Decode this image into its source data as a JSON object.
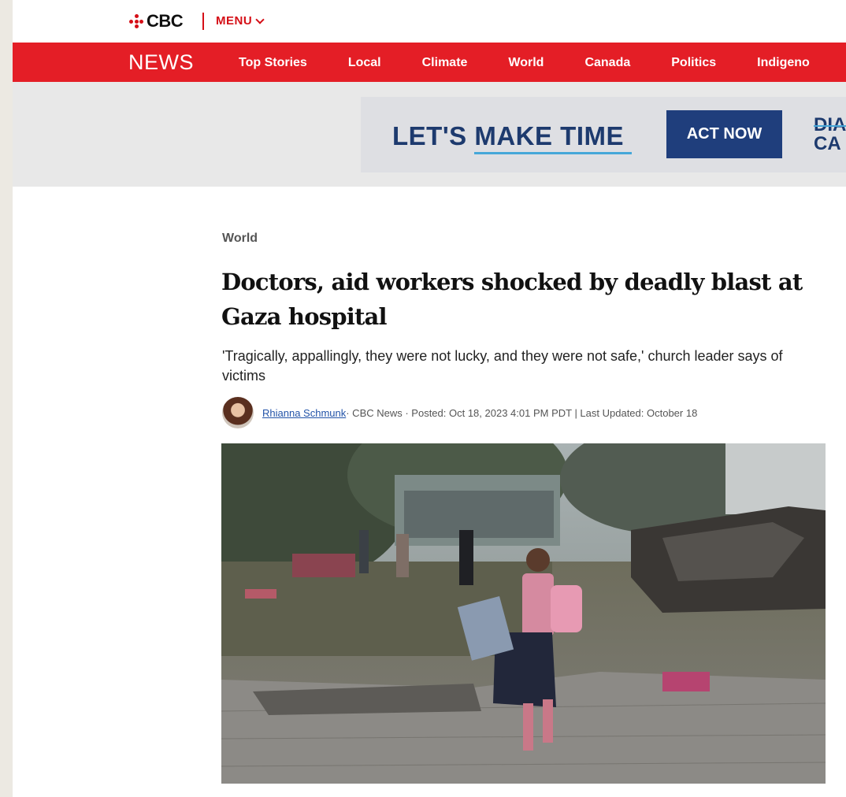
{
  "header": {
    "logo_text": "CBC",
    "menu_label": "MENU"
  },
  "nav": {
    "brand": "NEWS",
    "items": [
      "Top Stories",
      "Local",
      "Climate",
      "World",
      "Canada",
      "Politics",
      "Indigeno"
    ]
  },
  "ad": {
    "headline": "LET'S MAKE TIME",
    "cta": "ACT NOW",
    "logo_line1": "DIA",
    "logo_line2": "CA"
  },
  "article": {
    "section": "World",
    "headline": "Doctors, aid workers shocked by deadly blast at Gaza hospital",
    "dek": "'Tragically, appallingly, they were not lucky, and they were not safe,' church leader says of victims",
    "author": "Rhianna Schmunk",
    "meta": " · CBC News · Posted: Oct 18, 2023 4:01 PM PDT | Last Updated: October 18"
  },
  "colors": {
    "brand_red": "#e41e26",
    "ad_navy": "#1f3e7c",
    "link_blue": "#2253a8"
  }
}
